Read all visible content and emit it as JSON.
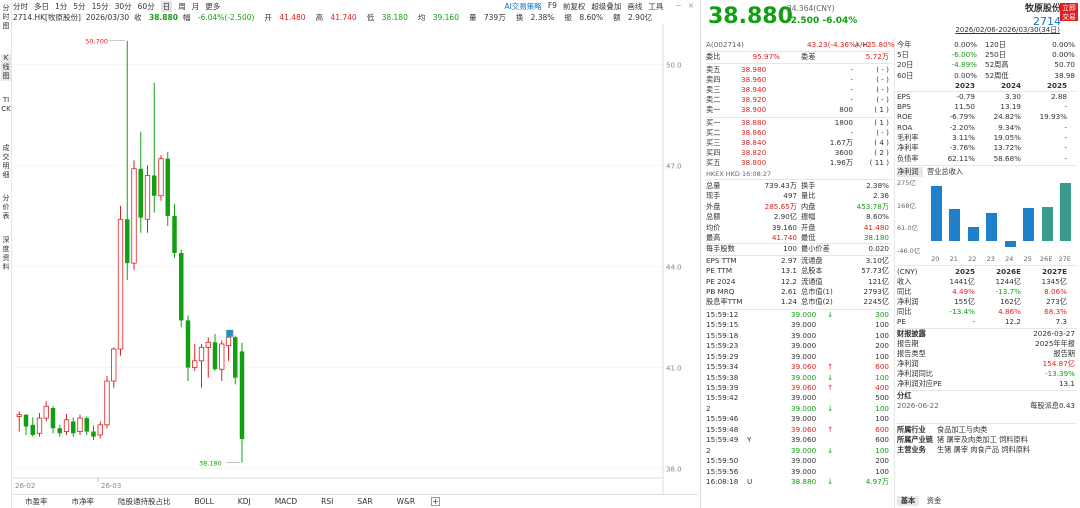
{
  "left_tabs": [
    "分时图",
    "K线图",
    "TICK",
    "成交明细",
    "分价表",
    "深度资料"
  ],
  "periods": [
    "分时",
    "多日",
    "1分",
    "5分",
    "15分",
    "30分",
    "60分",
    "日",
    "周",
    "月",
    "更多"
  ],
  "period_selected": "日",
  "toolbar_right": [
    "AI交易策略",
    "F9",
    "前复权",
    "超级叠加",
    "画线",
    "工具"
  ],
  "info": {
    "code": "2714.HK[牧原股份]",
    "date": "2026/03/30",
    "close_label": "收",
    "close": "38.880",
    "chg_label": "幅",
    "chg": "-6.04%(-2.500)",
    "open_label": "开",
    "open": "41.480",
    "high_label": "高",
    "high": "41.740",
    "low_label": "低",
    "low": "38.180",
    "prev_label": "均",
    "prev": "39.160",
    "vol_label": "量",
    "vol": "739万",
    "turn_label": "换",
    "turn": "2.38%",
    "amp_label": "振",
    "amp": "8.60%",
    "amt_label": "额",
    "amt": "2.90亿"
  },
  "date_range": "2026/02/06-2026/03/30(34日)",
  "chart_data": {
    "type": "candlestick",
    "y_ticks": [
      "50.0",
      "47.0",
      "44.0",
      "41.0",
      "38.0"
    ],
    "ylim": [
      37.9,
      50.9
    ],
    "x_labels": [
      "26-02",
      "26-03"
    ],
    "high_label": "50.700",
    "low_label": "38.180",
    "candles": [
      [
        39.55,
        39.7,
        39.1,
        39.6
      ],
      [
        39.6,
        39.62,
        39.0,
        39.25
      ],
      [
        39.3,
        39.52,
        38.95,
        39.0
      ],
      [
        39.05,
        39.65,
        38.95,
        39.5
      ],
      [
        39.5,
        40.0,
        39.4,
        39.85
      ],
      [
        39.8,
        39.85,
        39.05,
        39.2
      ],
      [
        39.2,
        39.3,
        38.95,
        39.05
      ],
      [
        39.1,
        39.62,
        39.0,
        39.45
      ],
      [
        39.4,
        39.52,
        38.95,
        39.05
      ],
      [
        39.1,
        39.6,
        39.0,
        39.5
      ],
      [
        39.5,
        39.55,
        39.0,
        39.1
      ],
      [
        39.1,
        39.28,
        38.85,
        38.95
      ],
      [
        39.0,
        39.4,
        38.9,
        39.3
      ],
      [
        39.3,
        40.75,
        39.2,
        40.6
      ],
      [
        40.6,
        41.6,
        40.4,
        41.55
      ],
      [
        41.55,
        45.8,
        41.35,
        45.4
      ],
      [
        45.4,
        50.7,
        43.6,
        44.1
      ],
      [
        44.1,
        47.15,
        43.9,
        46.9
      ],
      [
        46.9,
        48.0,
        45.0,
        45.45
      ],
      [
        45.4,
        47.0,
        45.0,
        46.7
      ],
      [
        46.7,
        49.45,
        45.6,
        46.1
      ],
      [
        46.1,
        47.3,
        45.95,
        47.2
      ],
      [
        47.2,
        47.4,
        45.2,
        45.5
      ],
      [
        45.5,
        45.85,
        44.25,
        44.4
      ],
      [
        44.4,
        44.5,
        42.2,
        42.4
      ],
      [
        42.4,
        42.55,
        40.6,
        41.0
      ],
      [
        41.0,
        41.7,
        40.9,
        41.2
      ],
      [
        41.2,
        41.7,
        40.4,
        41.6
      ],
      [
        41.6,
        41.9,
        40.7,
        41.75
      ],
      [
        41.75,
        42.0,
        40.9,
        40.95
      ],
      [
        40.95,
        41.8,
        40.6,
        41.7
      ],
      [
        41.65,
        42.05,
        41.2,
        41.9
      ],
      [
        41.9,
        41.95,
        40.5,
        40.7
      ],
      [
        41.48,
        41.74,
        38.18,
        38.88
      ]
    ]
  },
  "bottom_tabs": [
    "市盈率",
    "市净率",
    "陆股通持股占比",
    "BOLL",
    "KDJ",
    "MACD",
    "RSI",
    "SAR",
    "W&R"
  ],
  "quote": {
    "price": "38.880",
    "change": "-2.500",
    "pct": "-6.04%",
    "cny_line": "34.364(CNY)",
    "name": "牧原股份",
    "code": "2714",
    "btn": "立即交易",
    "ah_left": "A(002714)",
    "ah_price": "43.23(-4.36%)",
    "ah_label": "A/H:",
    "ah_premium": "+25.80%"
  },
  "order": {
    "wb_label": "委比",
    "wb": "95.97%",
    "wc_label": "委差",
    "wc": "5.72万",
    "asks": [
      [
        "卖五",
        "38.980",
        "-",
        "-"
      ],
      [
        "卖四",
        "38.960",
        "-",
        "-"
      ],
      [
        "卖三",
        "38.940",
        "-",
        "-"
      ],
      [
        "卖二",
        "38.920",
        "-",
        "-"
      ],
      [
        "卖一",
        "38.900",
        "800",
        "1"
      ]
    ],
    "bids": [
      [
        "买一",
        "38.880",
        "1800",
        "1"
      ],
      [
        "买二",
        "38.860",
        "-",
        "-"
      ],
      [
        "买三",
        "38.840",
        "1.67万",
        "4"
      ],
      [
        "买四",
        "38.820",
        "3600",
        "2"
      ],
      [
        "买五",
        "38.800",
        "1.96万",
        "11"
      ]
    ],
    "market": "HKEX HKD 16:08:27"
  },
  "stats": [
    [
      "总量",
      "739.43万",
      "换手",
      "2.38%"
    ],
    [
      "现手",
      "497",
      "量比",
      "2.36"
    ],
    [
      "外盘",
      "285.65万",
      "内盘",
      "453.78万"
    ],
    [
      "总额",
      "2.90亿",
      "振幅",
      "8.60%"
    ],
    [
      "均价",
      "39.160",
      "开盘",
      "41.480"
    ],
    [
      "最高",
      "41.740",
      "最低",
      "38.180"
    ],
    [
      "每手股数",
      "100",
      "最小价差",
      "0.020"
    ],
    [
      "EPS TTM",
      "2.97",
      "流通盘",
      "3.10亿"
    ],
    [
      "PE TTM",
      "13.1",
      "总股本",
      "57.73亿"
    ],
    [
      "PE 2024",
      "12.2",
      "流通值",
      "121亿"
    ],
    [
      "PB MRQ",
      "2.61",
      "总市值(1)",
      "2793亿"
    ],
    [
      "股息率TTM",
      "1.24",
      "总市值(2)",
      "2245亿"
    ]
  ],
  "ticks": [
    [
      "15:59:12",
      "39.000",
      "down",
      "300",
      ""
    ],
    [
      "15:59:15",
      "39.000",
      "",
      "100",
      ""
    ],
    [
      "15:59:18",
      "39.000",
      "",
      "100",
      ""
    ],
    [
      "15:59:23",
      "39.000",
      "",
      "200",
      ""
    ],
    [
      "15:59:29",
      "39.000",
      "",
      "100",
      ""
    ],
    [
      "15:59:34",
      "39.060",
      "up",
      "600",
      ""
    ],
    [
      "15:59:38",
      "39.000",
      "down",
      "100",
      ""
    ],
    [
      "15:59:39",
      "39.060",
      "up",
      "400",
      ""
    ],
    [
      "15:59:42",
      "39.000",
      "",
      "500",
      ""
    ],
    [
      "2",
      "39.000",
      "down",
      "100",
      ""
    ],
    [
      "15:59:46",
      "39.000",
      "",
      "100",
      ""
    ],
    [
      "15:59:48",
      "39.060",
      "up",
      "600",
      ""
    ],
    [
      "15:59:49",
      "39.060",
      "",
      "600",
      "Y"
    ],
    [
      "2",
      "39.000",
      "down",
      "100",
      ""
    ],
    [
      "15:59:50",
      "39.000",
      "",
      "200",
      ""
    ],
    [
      "15:59:56",
      "39.000",
      "",
      "100",
      ""
    ],
    [
      "16:08:18",
      "38.880",
      "down",
      "4.97万",
      "U"
    ]
  ],
  "perf": [
    [
      "今年",
      "0.00%",
      "120日",
      "0.00%"
    ],
    [
      "5日",
      "-6.00%",
      "250日",
      "0.00%"
    ],
    [
      "20日",
      "-4.89%",
      "52周高",
      "50.70"
    ],
    [
      "60日",
      "0.00%",
      "52周低",
      "38.98"
    ]
  ],
  "fin_years": [
    "2023",
    "2024",
    "2025"
  ],
  "fin": [
    [
      "EPS",
      "-0.79",
      "3.30",
      "2.88"
    ],
    [
      "BPS",
      "11.50",
      "13.19",
      "-"
    ],
    [
      "ROE",
      "-6.79%",
      "24.82%",
      "19.93%"
    ],
    [
      "ROA",
      "-2.20%",
      "9.34%",
      "-"
    ],
    [
      "毛利率",
      "3.11%",
      "19.05%",
      "-"
    ],
    [
      "净利率",
      "-3.76%",
      "13.72%",
      "-"
    ],
    [
      "负债率",
      "62.11%",
      "58.68%",
      "-"
    ]
  ],
  "tabs2": [
    "净利润",
    "营业总收入"
  ],
  "bars": {
    "ylabels": [
      "275亿",
      "168亿",
      "61.0亿",
      "-46.0亿"
    ],
    "xlabels": [
      "20",
      "21",
      "22",
      "23",
      "24",
      "25",
      "26E",
      "27E"
    ],
    "values": [
      260,
      150,
      69,
      135,
      -28,
      155,
      162,
      273
    ]
  },
  "forecast_head": [
    "(CNY)",
    "2025",
    "2026E",
    "2027E"
  ],
  "forecast": [
    [
      "收入",
      "1441亿",
      "1244亿",
      "1345亿"
    ],
    [
      "同比",
      "4.49%",
      "-13.7%",
      "8.06%"
    ],
    [
      "净利润",
      "155亿",
      "162亿",
      "273亿"
    ],
    [
      "同比",
      "-13.4%",
      "4.86%",
      "68.3%"
    ],
    [
      "PE",
      "-",
      "12.2",
      "7.3"
    ]
  ],
  "report_title": "财报披露",
  "report_date": "2026-03-27",
  "report": [
    [
      "报告期",
      "2025年年报"
    ],
    [
      "报告类型",
      "报告期"
    ],
    [
      "净利润",
      "154.87亿"
    ],
    [
      "净利润同比",
      "-13.39%"
    ],
    [
      "净利润对应PE",
      "13.1"
    ]
  ],
  "div_title": "分红",
  "div_date": "2026-06-22",
  "div_text": "每股派息0.43",
  "industry": [
    [
      "所属行业",
      "食品加工与肉类"
    ],
    [
      "所属产业链",
      "猪",
      "屠宰及肉类加工",
      "饲料原料"
    ],
    [
      "主营业务",
      "生猪",
      "屠宰",
      "肉食产品",
      "饲料原料"
    ]
  ],
  "footer_tabs": [
    "基本",
    "资金"
  ]
}
